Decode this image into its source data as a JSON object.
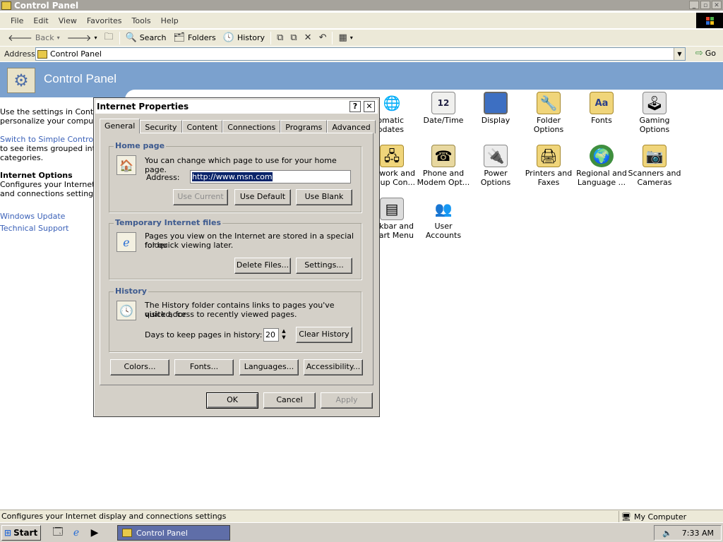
{
  "window": {
    "title": "Control Panel"
  },
  "menu": [
    "File",
    "Edit",
    "View",
    "Favorites",
    "Tools",
    "Help"
  ],
  "toolbar": {
    "back": "Back",
    "search": "Search",
    "folders": "Folders",
    "history": "History"
  },
  "address": {
    "label": "Address",
    "value": "Control Panel",
    "go": "Go"
  },
  "header": {
    "title": "Control Panel"
  },
  "left_pane": {
    "intro_line1": "Use the settings in Control",
    "intro_line2": "personalize your computer.",
    "switch_link": "Switch to Simple Control Pa",
    "switch_line2": "to see items grouped into",
    "switch_line3": "categories.",
    "selected_title": "Internet Options",
    "selected_line1": "Configures your Internet d",
    "selected_line2": "and connections settings",
    "link_update": "Windows Update",
    "link_support": "Technical Support"
  },
  "cp_items": [
    {
      "label": "utomatic\nUpdates"
    },
    {
      "label": "Date/Time"
    },
    {
      "label": "Display"
    },
    {
      "label": "Folder Options"
    },
    {
      "label": "Fonts"
    },
    {
      "label": "Gaming\nOptions"
    },
    {
      "label": "twork and\n-up Con..."
    },
    {
      "label": "Phone and\nModem Opt..."
    },
    {
      "label": "Power Options"
    },
    {
      "label": "Printers and\nFaxes"
    },
    {
      "label": "Regional and\nLanguage ..."
    },
    {
      "label": "Scanners and\nCameras"
    },
    {
      "label": "skbar and\nart Menu"
    },
    {
      "label": "User Accounts"
    }
  ],
  "dialog": {
    "title": "Internet Properties",
    "help": "?",
    "close": "✕",
    "tabs": [
      "General",
      "Security",
      "Content",
      "Connections",
      "Programs",
      "Advanced"
    ],
    "home": {
      "title": "Home page",
      "desc": "You can change which page to use for your home page.",
      "address_label": "Address:",
      "address_value": "http://www.msn.com",
      "use_current": "Use Current",
      "use_default": "Use Default",
      "use_blank": "Use Blank"
    },
    "temp": {
      "title": "Temporary Internet files",
      "desc_line1": "Pages you view on the Internet are stored in a special folder",
      "desc_line2": "for quick viewing later.",
      "delete": "Delete Files...",
      "settings": "Settings..."
    },
    "history": {
      "title": "History",
      "desc_line1": "The History folder contains links to pages you've visited, for",
      "desc_line2": "quick access to recently viewed pages.",
      "days_label": "Days to keep pages in history:",
      "days_value": "20",
      "clear": "Clear History"
    },
    "bottom": {
      "colors": "Colors...",
      "fonts": "Fonts...",
      "languages": "Languages...",
      "accessibility": "Accessibility..."
    },
    "ok": "OK",
    "cancel": "Cancel",
    "apply": "Apply"
  },
  "status": {
    "text": "Configures your Internet display and connections settings",
    "zone": "My Computer"
  },
  "taskbar": {
    "start": "Start",
    "task": "Control Panel",
    "clock": "7:33 AM"
  }
}
